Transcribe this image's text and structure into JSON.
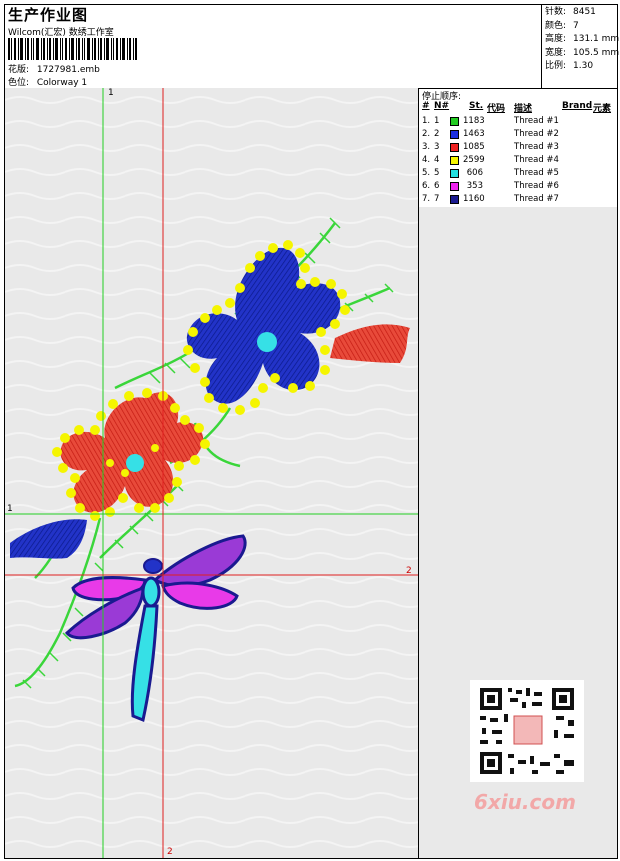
{
  "header": {
    "title": "生产作业图",
    "subtitle": "Wilcom(汇宏) 数绣工作室",
    "design_label": "花版:",
    "design_value": "1727981.emb",
    "colorway_label": "色位:",
    "colorway_value": "Colorway 1"
  },
  "stats": {
    "stitches_label": "针数:",
    "stitches_value": "8451",
    "colors_label": "颜色:",
    "colors_value": "7",
    "height_label": "高度:",
    "height_value": "131.1 mm",
    "width_label": "宽度:",
    "width_value": "105.5 mm",
    "scale_label": "比例:",
    "scale_value": "1.30"
  },
  "stop_sequence": {
    "header": "停止顺序:",
    "columns": {
      "num": "#",
      "n": "N#",
      "st": "St.",
      "code": "代码",
      "desc": "描述",
      "brand": "Brand",
      "element": "元素"
    },
    "rows": [
      {
        "num": "1.",
        "n": "1",
        "st": "1183",
        "desc": "Thread #1",
        "color": "#22cc22"
      },
      {
        "num": "2.",
        "n": "2",
        "st": "1463",
        "desc": "Thread #2",
        "color": "#1a2ee0"
      },
      {
        "num": "3.",
        "n": "3",
        "st": "1085",
        "desc": "Thread #3",
        "color": "#ee2222"
      },
      {
        "num": "4.",
        "n": "4",
        "st": "2599",
        "desc": "Thread #4",
        "color": "#f5f500"
      },
      {
        "num": "5.",
        "n": "5",
        "st": "606",
        "desc": "Thread #5",
        "color": "#22e0e0"
      },
      {
        "num": "6.",
        "n": "6",
        "st": "353",
        "desc": "Thread #6",
        "color": "#ee22ee"
      },
      {
        "num": "7.",
        "n": "7",
        "st": "1160",
        "desc": "Thread #7",
        "color": "#1a1a90"
      }
    ]
  },
  "crosshair": {
    "v1": "1",
    "h1": "1",
    "h2": "2",
    "v2": "2"
  },
  "watermark": "6xiu.com"
}
